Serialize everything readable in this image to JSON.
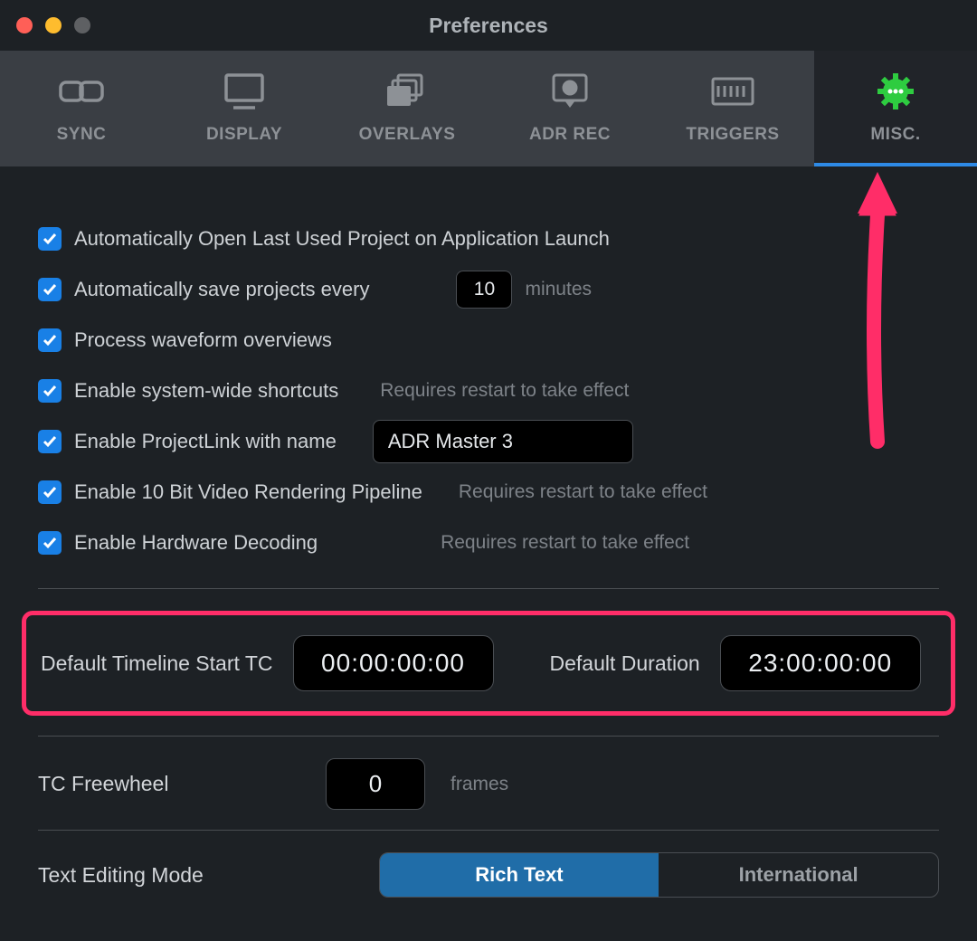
{
  "window": {
    "title": "Preferences"
  },
  "tabs": [
    {
      "id": "sync",
      "label": "SYNC"
    },
    {
      "id": "display",
      "label": "DISPLAY"
    },
    {
      "id": "overlays",
      "label": "OVERLAYS"
    },
    {
      "id": "adr_rec",
      "label": "ADR REC"
    },
    {
      "id": "triggers",
      "label": "TRIGGERS"
    },
    {
      "id": "misc",
      "label": "MISC."
    }
  ],
  "misc": {
    "auto_open_last": "Automatically Open Last Used Project on Application Launch",
    "auto_save_label": "Automatically save projects every",
    "auto_save_value": "10",
    "auto_save_unit": "minutes",
    "process_waveform": "Process waveform overviews",
    "enable_shortcuts": "Enable system-wide shortcuts",
    "restart_hint": "Requires restart to take effect",
    "enable_projectlink": "Enable ProjectLink with name",
    "projectlink_name": "ADR Master 3",
    "enable_10bit": "Enable 10 Bit Video Rendering Pipeline",
    "enable_hw_decode": "Enable Hardware Decoding",
    "default_start_tc_label": "Default Timeline Start TC",
    "default_start_tc_value": "00:00:00:00",
    "default_duration_label": "Default Duration",
    "default_duration_value": "23:00:00:00",
    "tc_freewheel_label": "TC Freewheel",
    "tc_freewheel_value": "0",
    "tc_freewheel_unit": "frames",
    "text_editing_label": "Text Editing Mode",
    "seg_rich": "Rich Text",
    "seg_intl": "International"
  },
  "annotation": {
    "highlight_color": "#ff2d68"
  }
}
